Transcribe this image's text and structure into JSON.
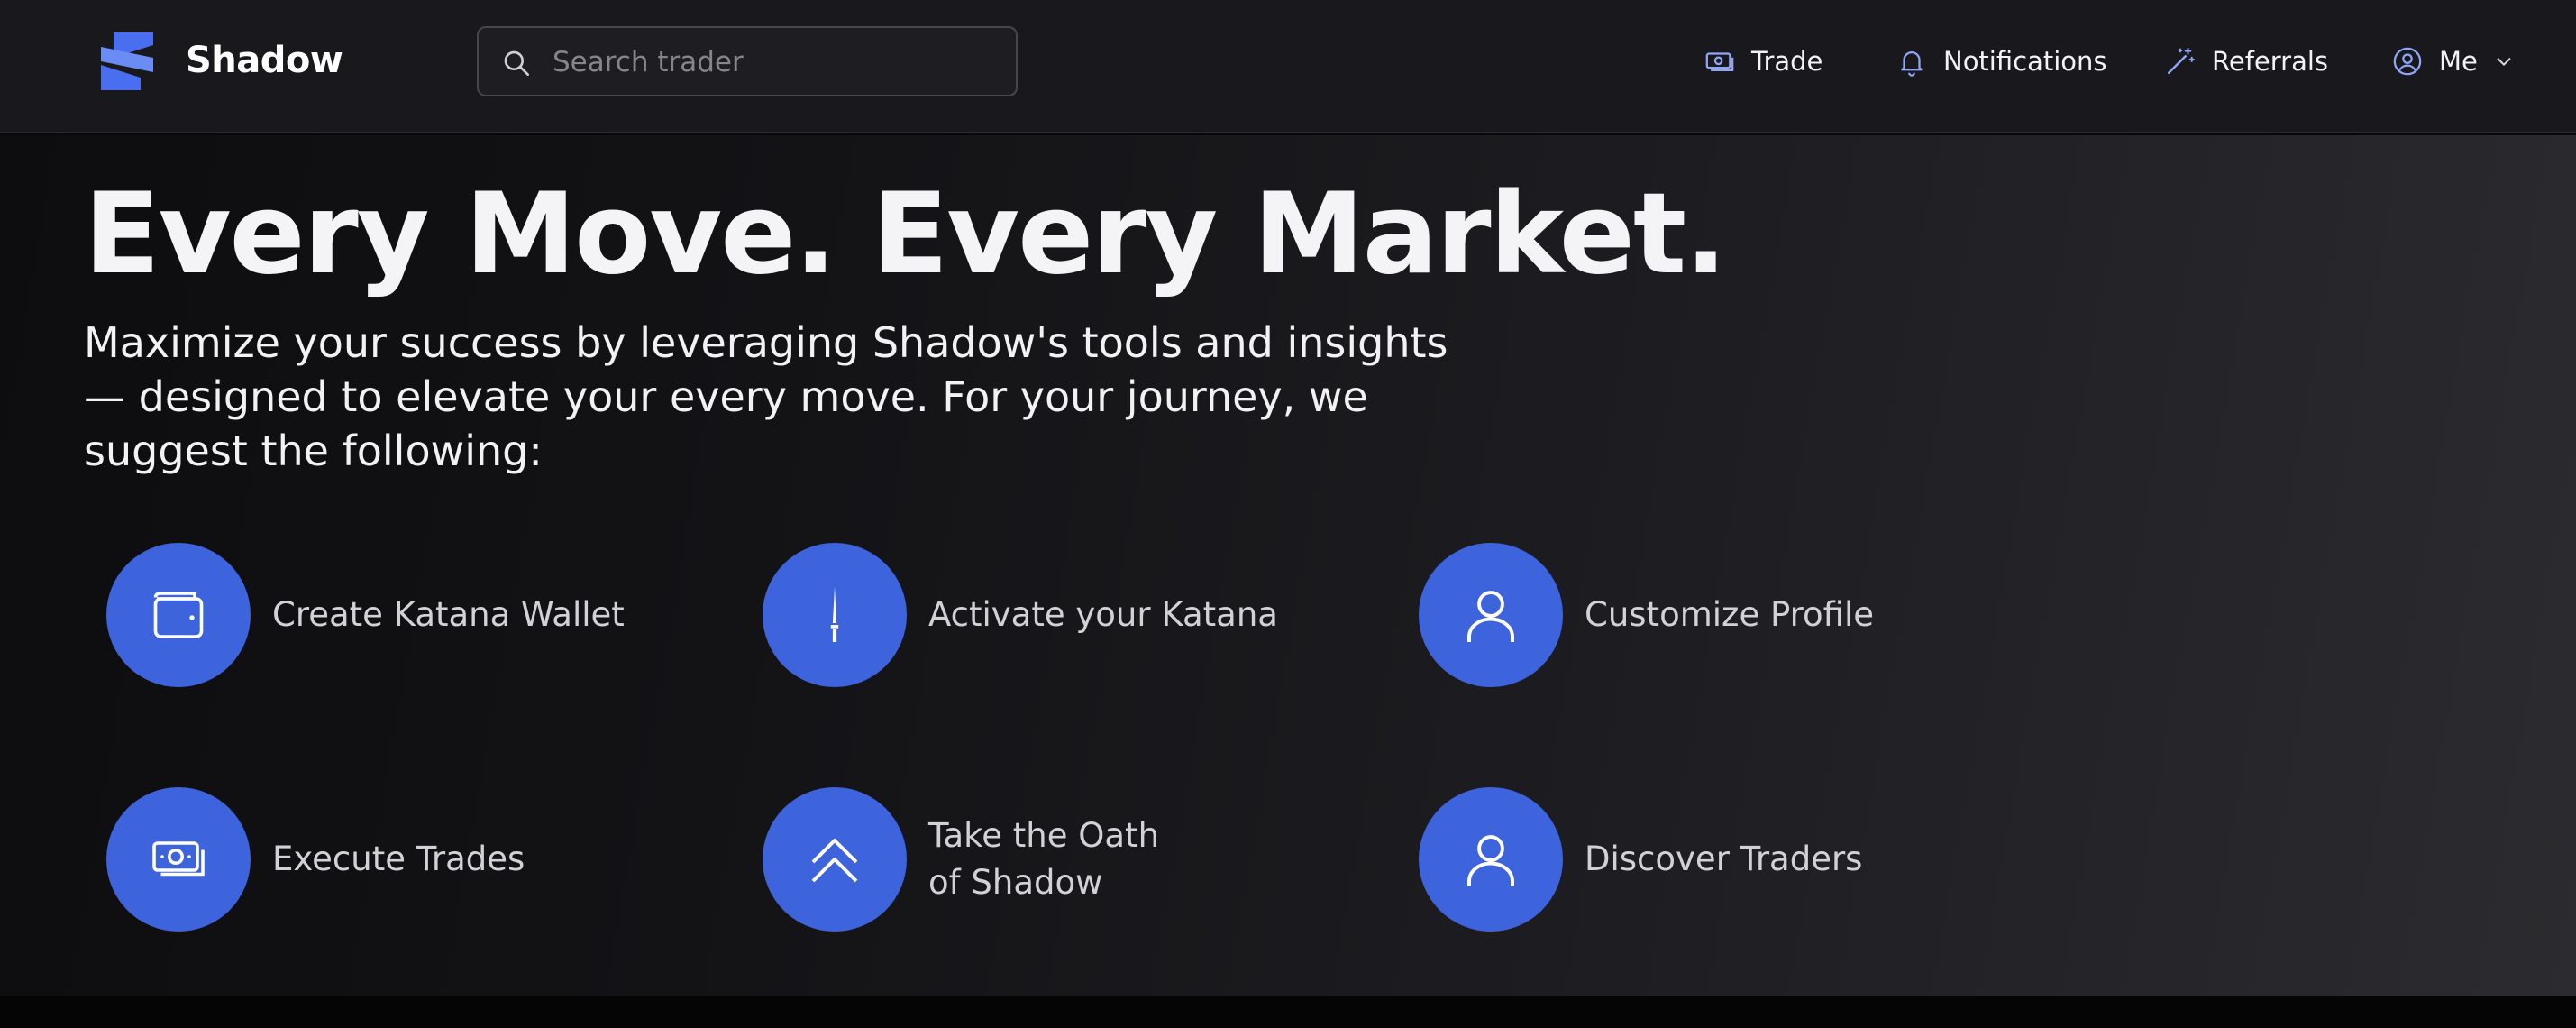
{
  "header": {
    "brand": "Shadow",
    "search_placeholder": "Search trader",
    "nav": [
      {
        "label": "Trade",
        "icon": "money-icon"
      },
      {
        "label": "Notifications",
        "icon": "bell-icon"
      },
      {
        "label": "Referrals",
        "icon": "magic-wand-icon"
      },
      {
        "label": "Me",
        "icon": "user-circle-icon"
      }
    ]
  },
  "hero": {
    "headline": "Every Move. Every Market.",
    "subtitle": "Maximize your success by leveraging Shadow's tools and insights — designed to elevate your every move. For your journey, we suggest the following:"
  },
  "steps": [
    {
      "label": "Create Katana Wallet",
      "icon": "wallet-icon"
    },
    {
      "label": "Activate your Katana",
      "icon": "katana-icon"
    },
    {
      "label": "Customize Profile",
      "icon": "user-icon"
    },
    {
      "label": "Execute Trades",
      "icon": "money-icon"
    },
    {
      "label": "Take the Oath of Shadow",
      "icon": "chevrons-up-icon"
    },
    {
      "label": "Discover Traders",
      "icon": "user-icon"
    }
  ],
  "colors": {
    "accent": "#3d63dd",
    "topbar": "#18181d",
    "background": "#07080a"
  }
}
